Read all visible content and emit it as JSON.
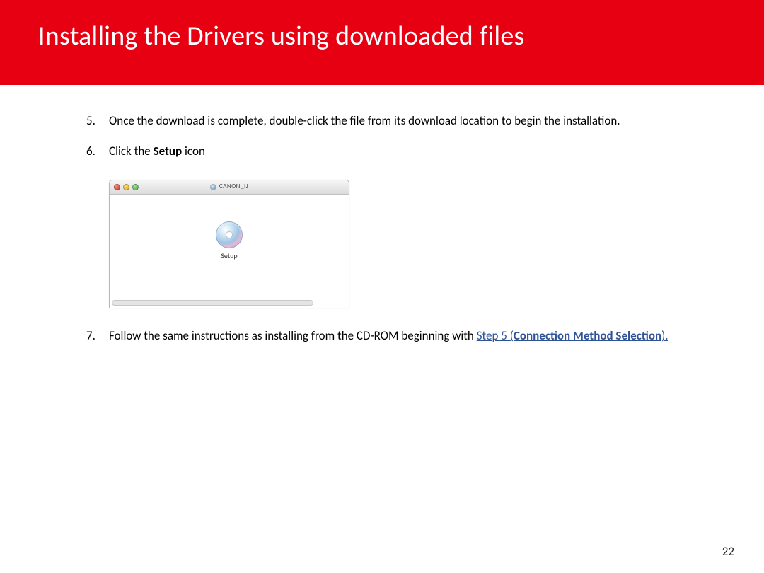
{
  "header": {
    "title": "Installing  the Drivers using downloaded files"
  },
  "steps": {
    "s5": {
      "n": "5.",
      "text": "Once the download is complete, double-click the file from its download location to begin the installation."
    },
    "s6": {
      "n": "6.",
      "pre": "Click the ",
      "bold": "Setup",
      "post": " icon"
    },
    "s7": {
      "n": "7.",
      "pre": "Follow the same instructions as installing from  the CD-ROM beginning with ",
      "link_pre": "Step 5 (",
      "link_bold": "Connection Method Selection",
      "link_post": ")."
    }
  },
  "window": {
    "title": "CANON_IJ",
    "icon_label": "Setup"
  },
  "page_number": "22"
}
